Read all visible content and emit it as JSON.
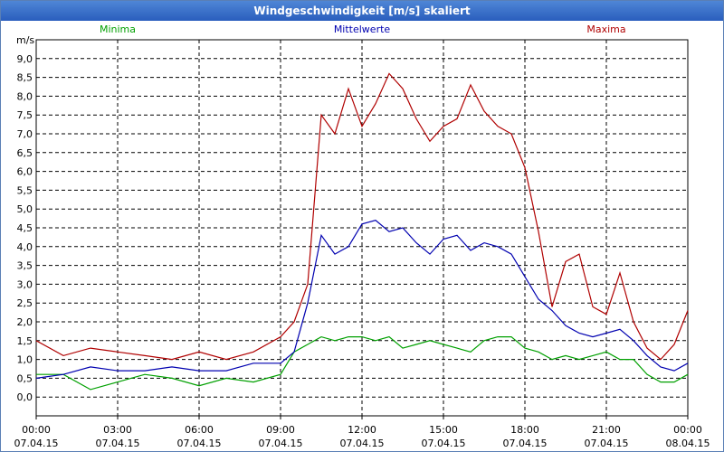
{
  "window": {
    "title": "Windgeschwindigkeit [m/s] skaliert"
  },
  "chart_data": {
    "type": "line",
    "title": "Windgeschwindigkeit [m/s] skaliert",
    "ylabel": "m/s",
    "xlabel": "",
    "ylim": [
      -0.5,
      9.5
    ],
    "xlim_hours": [
      0,
      24
    ],
    "grid": true,
    "legend_placement": "top",
    "y_ticks": [
      "0,0",
      "0,5",
      "1,0",
      "1,5",
      "2,0",
      "2,5",
      "3,0",
      "3,5",
      "4,0",
      "4,5",
      "5,0",
      "5,5",
      "6,0",
      "6,5",
      "7,0",
      "7,5",
      "8,0",
      "8,5",
      "9,0"
    ],
    "y_tick_values": [
      0,
      0.5,
      1,
      1.5,
      2,
      2.5,
      3,
      3.5,
      4,
      4.5,
      5,
      5.5,
      6,
      6.5,
      7,
      7.5,
      8,
      8.5,
      9
    ],
    "x_ticks": [
      {
        "time": "00:00",
        "date": "07.04.15"
      },
      {
        "time": "03:00",
        "date": "07.04.15"
      },
      {
        "time": "06:00",
        "date": "07.04.15"
      },
      {
        "time": "09:00",
        "date": "07.04.15"
      },
      {
        "time": "12:00",
        "date": "07.04.15"
      },
      {
        "time": "15:00",
        "date": "07.04.15"
      },
      {
        "time": "18:00",
        "date": "07.04.15"
      },
      {
        "time": "21:00",
        "date": "07.04.15"
      },
      {
        "time": "00:00",
        "date": "08.04.15"
      }
    ],
    "x_tick_hours": [
      0,
      3,
      6,
      9,
      12,
      15,
      18,
      21,
      24
    ],
    "series": [
      {
        "name": "Minima",
        "color": "#00a000",
        "points": [
          [
            0,
            0.6
          ],
          [
            1,
            0.6
          ],
          [
            2,
            0.2
          ],
          [
            3,
            0.4
          ],
          [
            4,
            0.6
          ],
          [
            5,
            0.5
          ],
          [
            6,
            0.3
          ],
          [
            7,
            0.5
          ],
          [
            8,
            0.4
          ],
          [
            9,
            0.6
          ],
          [
            9.5,
            1.2
          ],
          [
            10,
            1.4
          ],
          [
            10.5,
            1.6
          ],
          [
            11,
            1.5
          ],
          [
            11.5,
            1.6
          ],
          [
            12,
            1.6
          ],
          [
            12.5,
            1.5
          ],
          [
            13,
            1.6
          ],
          [
            13.5,
            1.3
          ],
          [
            14,
            1.4
          ],
          [
            14.5,
            1.5
          ],
          [
            15,
            1.4
          ],
          [
            15.5,
            1.3
          ],
          [
            16,
            1.2
          ],
          [
            16.5,
            1.5
          ],
          [
            17,
            1.6
          ],
          [
            17.5,
            1.6
          ],
          [
            18,
            1.3
          ],
          [
            18.5,
            1.2
          ],
          [
            19,
            1.0
          ],
          [
            19.5,
            1.1
          ],
          [
            20,
            1.0
          ],
          [
            20.5,
            1.1
          ],
          [
            21,
            1.2
          ],
          [
            21.5,
            1.0
          ],
          [
            22,
            1.0
          ],
          [
            22.5,
            0.6
          ],
          [
            23,
            0.4
          ],
          [
            23.5,
            0.4
          ],
          [
            24,
            0.6
          ]
        ]
      },
      {
        "name": "Mittelwerte",
        "color": "#0000b0",
        "points": [
          [
            0,
            0.5
          ],
          [
            1,
            0.6
          ],
          [
            2,
            0.8
          ],
          [
            3,
            0.7
          ],
          [
            4,
            0.7
          ],
          [
            5,
            0.8
          ],
          [
            6,
            0.7
          ],
          [
            7,
            0.7
          ],
          [
            8,
            0.9
          ],
          [
            9,
            0.9
          ],
          [
            9.5,
            1.2
          ],
          [
            10,
            2.5
          ],
          [
            10.5,
            4.3
          ],
          [
            11,
            3.8
          ],
          [
            11.5,
            4.0
          ],
          [
            12,
            4.6
          ],
          [
            12.5,
            4.7
          ],
          [
            13,
            4.4
          ],
          [
            13.5,
            4.5
          ],
          [
            14,
            4.1
          ],
          [
            14.5,
            3.8
          ],
          [
            15,
            4.2
          ],
          [
            15.5,
            4.3
          ],
          [
            16,
            3.9
          ],
          [
            16.5,
            4.1
          ],
          [
            17,
            4.0
          ],
          [
            17.5,
            3.8
          ],
          [
            18,
            3.2
          ],
          [
            18.5,
            2.6
          ],
          [
            19,
            2.3
          ],
          [
            19.5,
            1.9
          ],
          [
            20,
            1.7
          ],
          [
            20.5,
            1.6
          ],
          [
            21,
            1.7
          ],
          [
            21.5,
            1.8
          ],
          [
            22,
            1.5
          ],
          [
            22.5,
            1.1
          ],
          [
            23,
            0.8
          ],
          [
            23.5,
            0.7
          ],
          [
            24,
            0.9
          ]
        ]
      },
      {
        "name": "Maxima",
        "color": "#b00000",
        "points": [
          [
            0,
            1.5
          ],
          [
            1,
            1.1
          ],
          [
            2,
            1.3
          ],
          [
            3,
            1.2
          ],
          [
            4,
            1.1
          ],
          [
            5,
            1.0
          ],
          [
            6,
            1.2
          ],
          [
            7,
            1.0
          ],
          [
            8,
            1.2
          ],
          [
            9,
            1.6
          ],
          [
            9.5,
            2.0
          ],
          [
            10,
            3.0
          ],
          [
            10.5,
            7.5
          ],
          [
            11,
            7.0
          ],
          [
            11.5,
            8.2
          ],
          [
            12,
            7.2
          ],
          [
            12.5,
            7.8
          ],
          [
            13,
            8.6
          ],
          [
            13.5,
            8.2
          ],
          [
            14,
            7.4
          ],
          [
            14.5,
            6.8
          ],
          [
            15,
            7.2
          ],
          [
            15.5,
            7.4
          ],
          [
            16,
            8.3
          ],
          [
            16.5,
            7.6
          ],
          [
            17,
            7.2
          ],
          [
            17.5,
            7.0
          ],
          [
            18,
            6.1
          ],
          [
            18.5,
            4.4
          ],
          [
            19,
            2.4
          ],
          [
            19.5,
            3.6
          ],
          [
            20,
            3.8
          ],
          [
            20.5,
            2.4
          ],
          [
            21,
            2.2
          ],
          [
            21.5,
            3.3
          ],
          [
            22,
            2.0
          ],
          [
            22.5,
            1.3
          ],
          [
            23,
            1.0
          ],
          [
            23.5,
            1.4
          ],
          [
            24,
            2.3
          ]
        ]
      }
    ]
  }
}
